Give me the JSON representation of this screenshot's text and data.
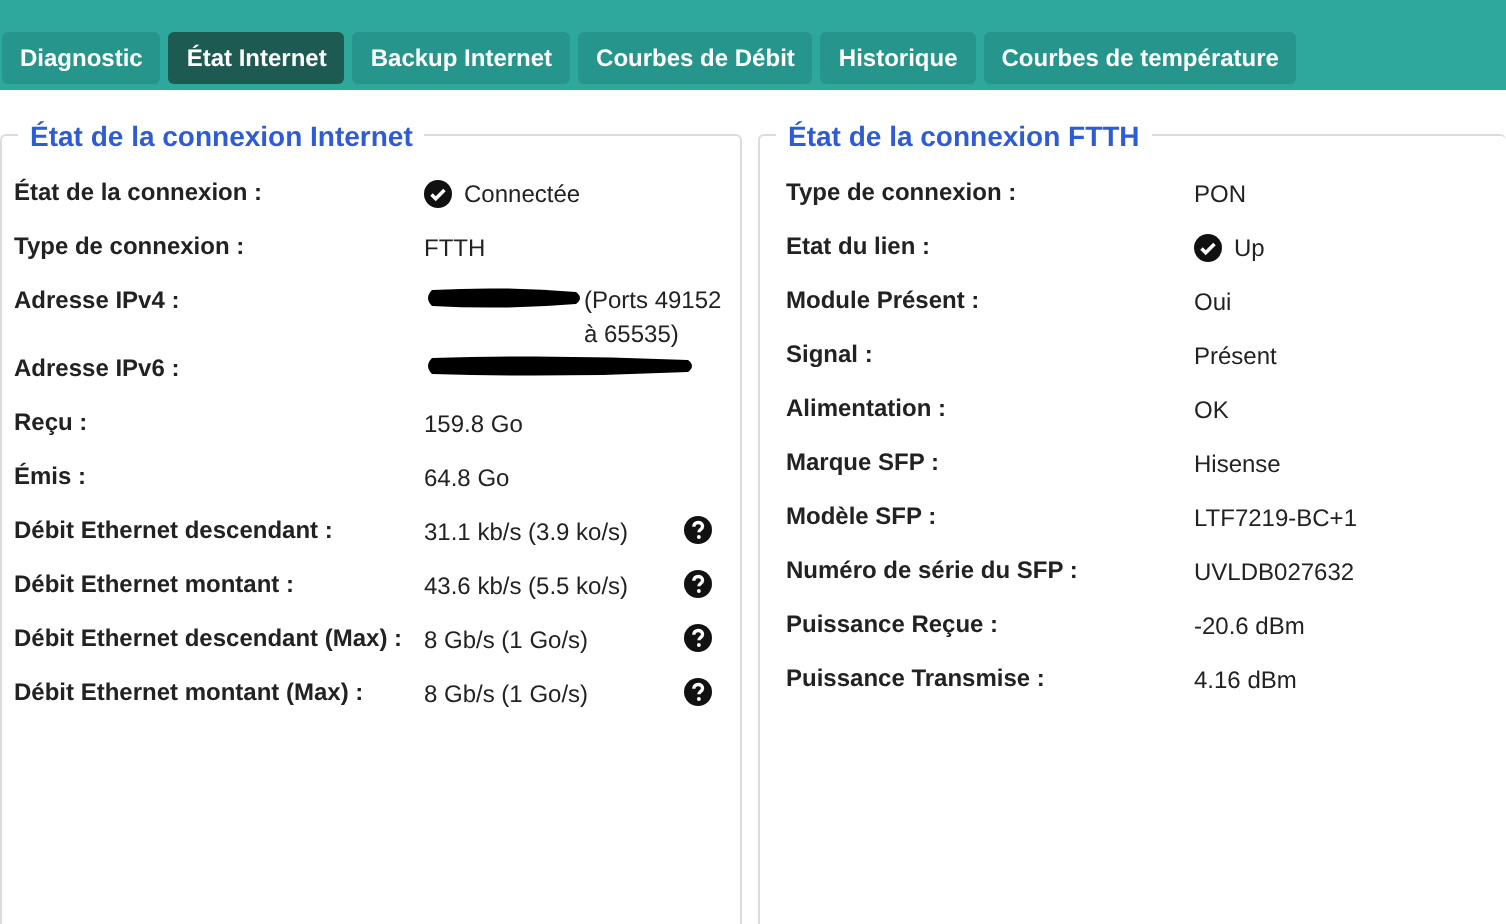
{
  "tabs": [
    {
      "label": "Diagnostic",
      "selected": false
    },
    {
      "label": "État Internet",
      "selected": true
    },
    {
      "label": "Backup Internet",
      "selected": false
    },
    {
      "label": "Courbes de Débit",
      "selected": false
    },
    {
      "label": "Historique",
      "selected": false
    },
    {
      "label": "Courbes de température",
      "selected": false
    }
  ],
  "panels": [
    {
      "title": "État de la connexion Internet",
      "rows": [
        {
          "label": "État de la connexion :",
          "value": "Connectée",
          "kind": "status",
          "help": false
        },
        {
          "label": "Type de connexion :",
          "value": "FTTH",
          "kind": "text",
          "help": false
        },
        {
          "label": "Adresse IPv4 :",
          "value": "(Ports 49152 à 65535)",
          "kind": "redacted",
          "help": false
        },
        {
          "label": "Adresse IPv6 :",
          "kind": "redacted",
          "help": false
        },
        {
          "label": "Reçu :",
          "value": "159.8 Go",
          "kind": "text",
          "help": false
        },
        {
          "label": "Émis :",
          "value": "64.8 Go",
          "kind": "text",
          "help": false
        },
        {
          "label": "Débit Ethernet descendant :",
          "value": "31.1 kb/s (3.9 ko/s)",
          "kind": "text",
          "help": true
        },
        {
          "label": "Débit Ethernet montant :",
          "value": "43.6 kb/s (5.5 ko/s)",
          "kind": "text",
          "help": true
        },
        {
          "label": "Débit Ethernet descendant (Max) :",
          "value": "8 Gb/s (1 Go/s)",
          "kind": "text",
          "help": true
        },
        {
          "label": "Débit Ethernet montant (Max) :",
          "value": "8 Gb/s (1 Go/s)",
          "kind": "text",
          "help": true
        }
      ]
    },
    {
      "title": "État de la connexion FTTH",
      "rows": [
        {
          "label": "Type de connexion :",
          "value": "PON",
          "kind": "text"
        },
        {
          "label": "Etat du lien :",
          "value": "Up",
          "kind": "status"
        },
        {
          "label": "Module Présent :",
          "value": "Oui",
          "kind": "text"
        },
        {
          "label": "Signal :",
          "value": "Présent",
          "kind": "text"
        },
        {
          "label": "Alimentation :",
          "value": "OK",
          "kind": "text"
        },
        {
          "label": "Marque SFP :",
          "value": "Hisense",
          "kind": "text"
        },
        {
          "label": "Modèle SFP :",
          "value": "LTF7219-BC+1",
          "kind": "text"
        },
        {
          "label": "Numéro de série du SFP :",
          "value": "UVLDB027632",
          "kind": "text"
        },
        {
          "label": "Puissance Reçue :",
          "value": "-20.6 dBm",
          "kind": "text"
        },
        {
          "label": "Puissance Transmise :",
          "value": "4.16 dBm",
          "kind": "text"
        }
      ]
    }
  ]
}
